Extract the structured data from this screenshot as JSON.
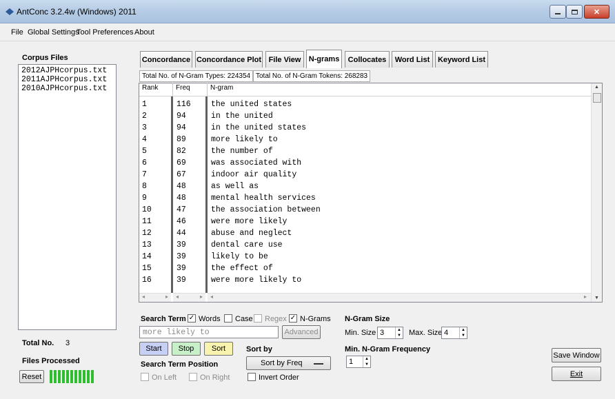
{
  "window": {
    "title": "AntConc 3.2.4w (Windows) 2011"
  },
  "menu": [
    "File",
    "Global Settings",
    "Tool Preferences",
    "About"
  ],
  "corpus": {
    "label": "Corpus Files",
    "files": [
      "2012AJPHcorpus.txt",
      "2011AJPHcorpus.txt",
      "2010AJPHcorpus.txt"
    ],
    "total_label": "Total No.",
    "total_value": "3",
    "processed_label": "Files Processed",
    "reset_label": "Reset",
    "progress": 1.0
  },
  "tabs": [
    "Concordance",
    "Concordance Plot",
    "File View",
    "N-grams",
    "Collocates",
    "Word List",
    "Keyword List"
  ],
  "active_tab": "N-grams",
  "stats": {
    "types": "Total No. of N-Gram Types: 224354",
    "tokens": "Total No. of N-Gram Tokens: 268283"
  },
  "table": {
    "headers": [
      "Rank",
      "Freq",
      "N-gram"
    ],
    "rows": [
      [
        "1",
        "116",
        "the united states"
      ],
      [
        "2",
        "94",
        "in the united"
      ],
      [
        "3",
        "94",
        "in the united states"
      ],
      [
        "4",
        "89",
        "more likely to"
      ],
      [
        "5",
        "82",
        "the number of"
      ],
      [
        "6",
        "69",
        "was associated with"
      ],
      [
        "7",
        "67",
        "indoor air quality"
      ],
      [
        "8",
        "48",
        "as well as"
      ],
      [
        "9",
        "48",
        "mental health services"
      ],
      [
        "10",
        "47",
        "the association between"
      ],
      [
        "11",
        "46",
        "were more likely"
      ],
      [
        "12",
        "44",
        "abuse and neglect"
      ],
      [
        "13",
        "39",
        "dental care use"
      ],
      [
        "14",
        "39",
        "likely to be"
      ],
      [
        "15",
        "39",
        "the effect of"
      ],
      [
        "16",
        "39",
        "were more likely to"
      ]
    ]
  },
  "search": {
    "label": "Search Term",
    "words_label": "Words",
    "words_checked": true,
    "case_label": "Case",
    "case_checked": false,
    "regex_label": "Regex",
    "regex_checked": false,
    "ngrams_label": "N-Grams",
    "ngrams_checked": true,
    "value": "more likely to",
    "advanced_label": "Advanced",
    "start_label": "Start",
    "stop_label": "Stop",
    "sort_label": "Sort",
    "position_label": "Search Term Position",
    "on_left_label": "On Left",
    "on_right_label": "On Right"
  },
  "sort": {
    "label": "Sort by",
    "selected": "Sort by Freq",
    "invert_label": "Invert Order"
  },
  "ngram": {
    "size_label": "N-Gram Size",
    "min_label": "Min. Size",
    "min_value": "3",
    "max_label": "Max. Size",
    "max_value": "4",
    "freq_label": "Min. N-Gram Frequency",
    "freq_value": "1"
  },
  "actions": {
    "save_window": "Save Window",
    "exit": "Exit"
  },
  "colors": {
    "start_bg": "#c8cff5",
    "stop_bg": "#c8f0c8",
    "sort_bg": "#f8f4b0",
    "progress": "#2fbe2f"
  }
}
